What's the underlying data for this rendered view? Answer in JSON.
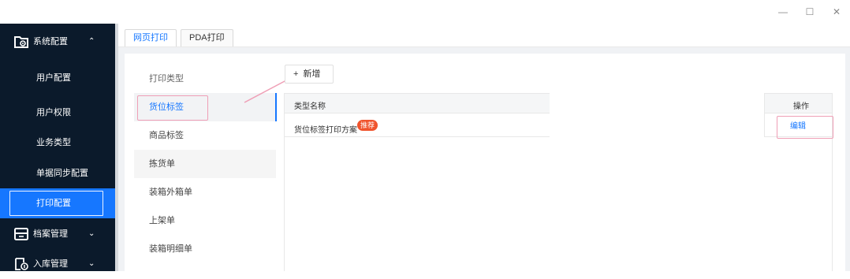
{
  "window": {
    "min_icon": "minimize-icon",
    "max_icon": "maximize-icon",
    "close_icon": "close-icon",
    "min_glyph": "—",
    "max_glyph": "☐",
    "close_glyph": "✕"
  },
  "sidebar": {
    "groups": [
      {
        "label": "系统配置",
        "icon": "settings-folder-icon",
        "chevron": "⌃"
      },
      {
        "label": "档案管理",
        "icon": "archive-icon",
        "chevron": "⌄"
      },
      {
        "label": "入库管理",
        "icon": "inbound-icon",
        "chevron": "⌄"
      }
    ],
    "items": [
      {
        "label": "用户配置"
      },
      {
        "label": "用户权限"
      },
      {
        "label": "业务类型"
      },
      {
        "label": "单据同步配置"
      },
      {
        "label": "打印配置"
      }
    ]
  },
  "tabs": [
    {
      "label": "网页打印"
    },
    {
      "label": "PDA打印"
    }
  ],
  "print_types": {
    "header": "打印类型",
    "items": [
      {
        "label": "货位标签"
      },
      {
        "label": "商品标签"
      },
      {
        "label": "拣货单"
      },
      {
        "label": "装箱外箱单"
      },
      {
        "label": "上架单"
      },
      {
        "label": "装箱明细单"
      }
    ]
  },
  "toolbar": {
    "add_label": "新增",
    "add_glyph": "+"
  },
  "table": {
    "columns": {
      "name": "类型名称",
      "op": "操作"
    },
    "rows": [
      {
        "name": "货位标签打印方案",
        "badge": "推荐",
        "action": "编辑"
      }
    ]
  },
  "colors": {
    "accent": "#1677ff",
    "sidebar_bg": "#0b1a2b",
    "highlight_pink": "#ef9fb6",
    "badge": "#f0542d"
  }
}
